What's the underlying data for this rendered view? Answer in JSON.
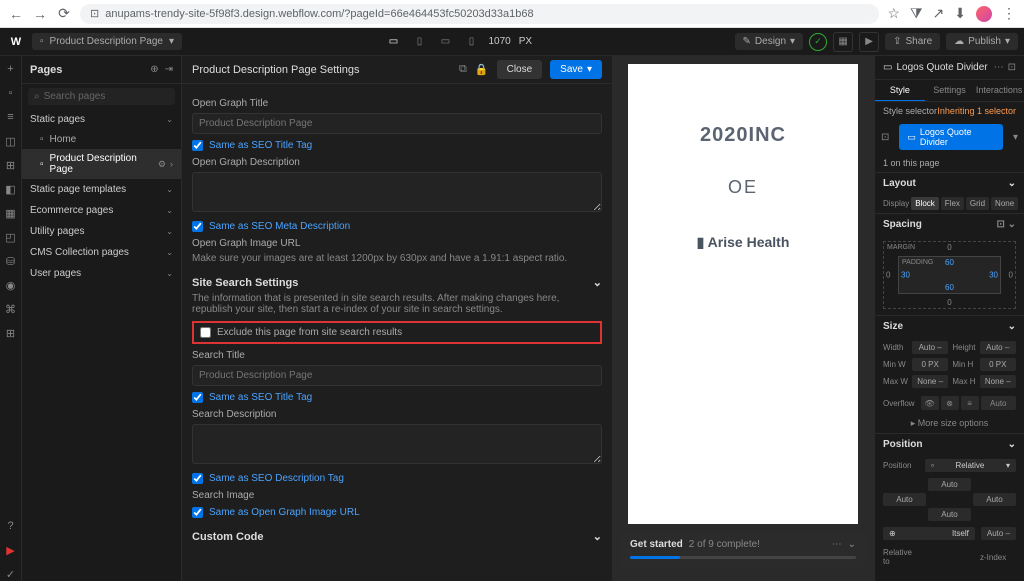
{
  "browser": {
    "url": "anupams-trendy-site-5f98f3.design.webflow.com/?pageId=66e464453fc50203d33a1b68"
  },
  "topbar": {
    "page_name": "Product Description Page",
    "canvas_width": "1070",
    "px_label": "PX",
    "design_btn": "Design",
    "share_btn": "Share",
    "publish_btn": "Publish"
  },
  "pages_panel": {
    "title": "Pages",
    "search_placeholder": "Search pages",
    "sections": {
      "static_pages": "Static pages",
      "static_templates": "Static page templates",
      "ecommerce": "Ecommerce pages",
      "utility": "Utility pages",
      "cms": "CMS Collection pages",
      "user": "User pages"
    },
    "static_items": [
      "Home",
      "Product Description Page"
    ]
  },
  "settings": {
    "title": "Product Description Page Settings",
    "close": "Close",
    "save": "Save",
    "og_title_label": "Open Graph Title",
    "og_title_placeholder": "Product Description Page",
    "same_seo_title": "Same as SEO Title Tag",
    "og_desc_label": "Open Graph Description",
    "same_seo_meta": "Same as SEO Meta Description",
    "og_image_label": "Open Graph Image URL",
    "og_image_help": "Make sure your images are at least 1200px by 630px and have a 1.91:1 aspect ratio.",
    "site_search_hdr": "Site Search Settings",
    "site_search_help": "The information that is presented in site search results. After making changes here, republish your site, then start a re-index of your site in search settings.",
    "exclude_label": "Exclude this page from site search results",
    "search_title_label": "Search Title",
    "search_title_placeholder": "Product Description Page",
    "same_seo_title2": "Same as SEO Title Tag",
    "search_desc_label": "Search Description",
    "same_seo_desc_tag": "Same as SEO Description Tag",
    "search_image_label": "Search Image",
    "same_og_image": "Same as Open Graph Image URL",
    "custom_code_hdr": "Custom Code"
  },
  "canvas": {
    "logo1": "2020INC",
    "logo2": "OE",
    "logo3": "▮ Arise Health",
    "get_started": "Get started",
    "progress_text": "2 of 9 complete!"
  },
  "style": {
    "element_name": "Logos Quote Divider",
    "tab_style": "Style",
    "tab_settings": "Settings",
    "tab_interactions": "Interactions",
    "selector_label": "Style selector",
    "inheriting": "Inheriting",
    "inheriting_count": "1 selector",
    "class_name": "Logos Quote Divider",
    "on_page": "1 on this page",
    "layout_hdr": "Layout",
    "display_label": "Display",
    "display_opts": [
      "Block",
      "Flex",
      "Grid",
      "None"
    ],
    "spacing_hdr": "Spacing",
    "margin_label": "MARGIN",
    "padding_label": "PADDING",
    "spacing": {
      "m_top": "0",
      "m_bot": "0",
      "m_left": "0",
      "m_right": "0",
      "p_top": "60",
      "p_bot": "60",
      "p_left": "30",
      "p_right": "30"
    },
    "size_hdr": "Size",
    "width": "Width",
    "height": "Height",
    "minw": "Min W",
    "minh": "Min H",
    "maxw": "Max W",
    "maxh": "Max H",
    "auto": "Auto",
    "zero": "0",
    "none": "None",
    "px": "PX",
    "overflow": "Overflow",
    "more_size": "More size options",
    "position_hdr": "Position",
    "position": "Position",
    "relative": "Relative",
    "rel_to": "Relative to",
    "zindex": "z-Index",
    "itself": "Itself"
  }
}
